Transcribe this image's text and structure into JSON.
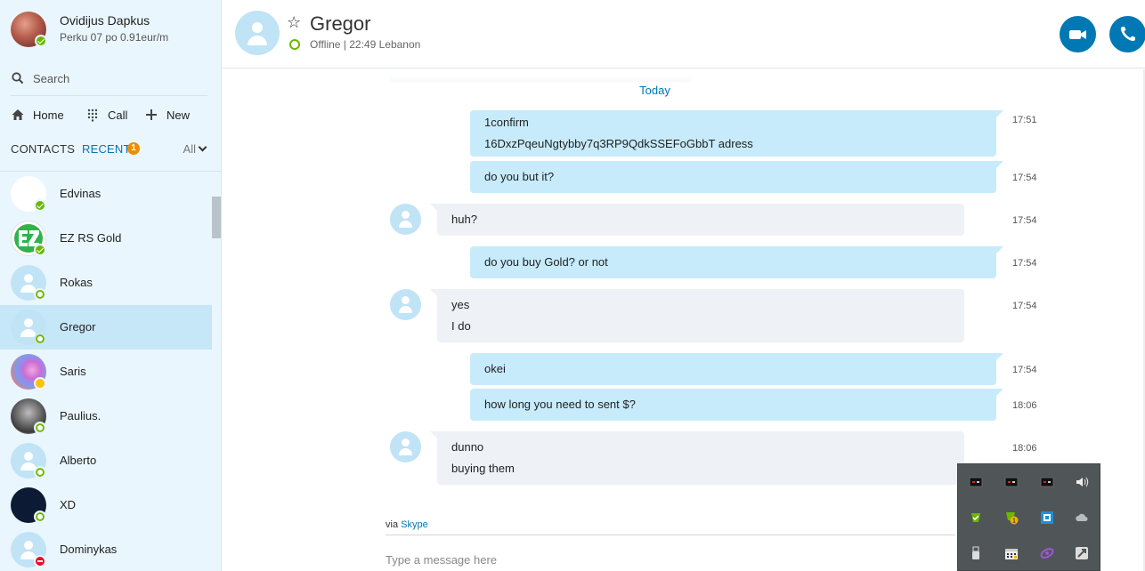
{
  "profile": {
    "name": "Ovidijus Dapkus",
    "mood": "Perku 07 po 0.91eur/m",
    "status": "online"
  },
  "search": {
    "placeholder": "Search",
    "icon": "search-icon"
  },
  "nav": {
    "home": "Home",
    "call": "Call",
    "new": "New"
  },
  "tabs": {
    "contacts": "CONTACTS",
    "recent": "RECENT",
    "recent_badge": "1",
    "filter": "All"
  },
  "contacts": [
    {
      "name": "Edvinas",
      "status": "online",
      "avatar": "blank-white"
    },
    {
      "name": "EZ RS Gold",
      "status": "online",
      "avatar": "ez-logo"
    },
    {
      "name": "Rokas",
      "status": "offline",
      "avatar": "default"
    },
    {
      "name": "Gregor",
      "status": "offline",
      "avatar": "default",
      "selected": true
    },
    {
      "name": "Saris",
      "status": "away",
      "avatar": "photo"
    },
    {
      "name": "Paulius.",
      "status": "offline",
      "avatar": "photo"
    },
    {
      "name": "Alberto",
      "status": "offline",
      "avatar": "default"
    },
    {
      "name": "XD",
      "status": "offline",
      "avatar": "dark"
    },
    {
      "name": "Dominykas",
      "status": "dnd",
      "avatar": "default"
    }
  ],
  "conversation": {
    "title": "Gregor",
    "presence": "Offline | 22:49 Lebanon",
    "date_separator": "Today",
    "via_prefix": "via",
    "via_link": "Skype",
    "compose_placeholder": "Type a message here",
    "messages": [
      {
        "dir": "out",
        "lines": [
          "1confirm",
          "16DxzPqeuNgtybby7q3RP9QdkSSEFoGbbT adress"
        ],
        "time": "17:51"
      },
      {
        "dir": "out",
        "lines": [
          "do you but it?"
        ],
        "time": "17:54"
      },
      {
        "dir": "in",
        "lines": [
          "huh?"
        ],
        "time": "17:54"
      },
      {
        "dir": "out",
        "lines": [
          "do you buy Gold? or not"
        ],
        "time": "17:54"
      },
      {
        "dir": "in",
        "lines": [
          "yes",
          "I do"
        ],
        "time": "17:54"
      },
      {
        "dir": "out",
        "lines": [
          "okei"
        ],
        "time": "17:54"
      },
      {
        "dir": "out",
        "lines": [
          "how long you need to sent $?"
        ],
        "time": "18:06"
      },
      {
        "dir": "in",
        "lines": [
          "dunno",
          "buying them"
        ],
        "time": "18:06"
      }
    ]
  },
  "header_actions": {
    "video_icon": "video-camera-icon",
    "call_icon": "phone-icon"
  },
  "tray_icons": [
    "app-tray-icon-1",
    "app-tray-icon-2",
    "app-tray-icon-3",
    "volume-icon",
    "green-app-icon",
    "notification-app-icon",
    "blue-app-icon",
    "cloud-icon",
    "usb-icon",
    "calendar-icon",
    "purple-app-icon",
    "gray-app-icon"
  ],
  "colors": {
    "accent": "#0078b4",
    "sidebar_bg": "#eaf6fd",
    "outgoing_bubble": "#c7ebfb",
    "incoming_bubble": "#eef1f5",
    "online": "#6bb700",
    "away": "#ffc107",
    "dnd": "#e81123"
  }
}
